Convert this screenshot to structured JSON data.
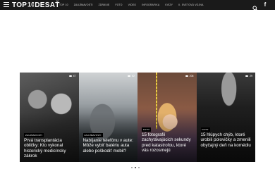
{
  "header": {
    "logo_left": "TOP",
    "logo_right": "DESAŤ",
    "nav": [
      "TOP 10",
      "ZAUJÍMAVOSTI",
      "ZDRAVIE",
      "FOTO",
      "VIDEO",
      "INFOGRAFIKA",
      "KVÍZY",
      "II. SVETOVÁ VOJNA"
    ],
    "icons": {
      "menu": "hamburger-icon",
      "search": "search-icon",
      "social": "facebook-icon"
    }
  },
  "cards": [
    {
      "category": "ZAUJÍMAVOSTI",
      "title": "Prvá transplantácia obličky: Kto vykonal historický medicínsky zákrok",
      "views": "47"
    },
    {
      "category": "ZAUJÍMAVOSTI",
      "title": "Nabíjanie telefónu v aute: Môže vybiť batériu auta alebo poškodiť mobil?",
      "views": "62"
    },
    {
      "category": "FOTO",
      "title": "15 fotografií zachytávajúcich sekundy pred katastrofou, ktoré vás rozosmejú",
      "views": "206"
    },
    {
      "category": "FOTO",
      "title": "15 hlúpych chýb, ktoré urobili polovičky a zmenili obyčajný deň na komédiu",
      "views": "29"
    }
  ],
  "carousel": {
    "dot_count": 3,
    "active_dot": 1
  }
}
